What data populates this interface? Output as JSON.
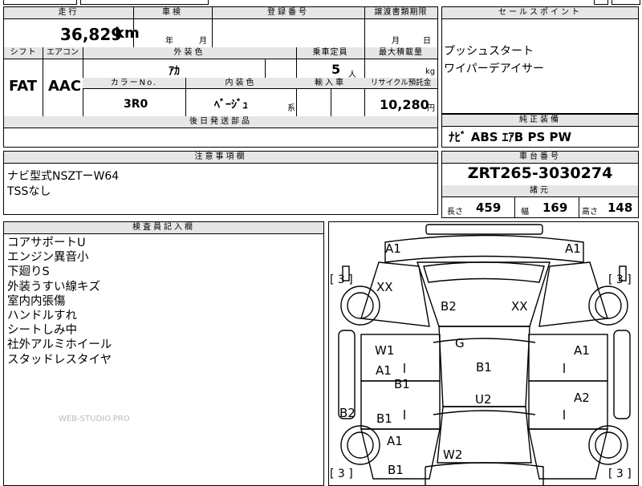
{
  "top_values": {
    "mileage": "36,829",
    "mileage_unit": "km",
    "inspection_year_unit": "年",
    "inspection_month_unit": "月",
    "transfer_month_unit": "月",
    "transfer_day_unit": "日"
  },
  "headers": {
    "mileage": "走行",
    "inspection": "車検",
    "registration": "登録番号",
    "transfer_deadline": "譲渡書類期限",
    "sales_point": "セールスポイント",
    "shift": "シフト",
    "aircon": "エアコン",
    "exterior_color": "外装色",
    "capacity": "乗車定員",
    "max_load": "最大積載量",
    "color_no": "カラーNo.",
    "interior_color": "内装色",
    "import": "輸入車",
    "recycle": "リサイクル預託金",
    "later_parts": "後日発送部品",
    "genuine_equipment": "純正装備",
    "notes": "注意事項欄",
    "chassis_no": "車台番号",
    "specs": "諸元",
    "inspector": "検査員記入欄"
  },
  "vehicle": {
    "shift": "FAT",
    "aircon": "AAC",
    "exterior_color": "ｱｶ",
    "capacity": "5",
    "capacity_unit": "人",
    "max_load_unit": "kg",
    "color_no": "3R0",
    "interior_color": "ﾍﾞｰｼﾞｭ",
    "interior_suffix": "系",
    "recycle_fee": "10,280",
    "recycle_unit": "円"
  },
  "sales_points": [
    "プッシュスタート",
    "ワイパーデアイサー"
  ],
  "genuine_equipment": "ﾅﾋﾞ ABS ｴｱB PS PW",
  "notes": [
    "ナビ型式NSZTーW64",
    "TSSなし"
  ],
  "chassis_no": "ZRT265-3030274",
  "specs": {
    "length_label": "長さ",
    "length": "459",
    "width_label": "幅",
    "width": "169",
    "height_label": "高さ",
    "height": "148"
  },
  "inspector_notes": [
    "コアサポートU",
    "エンジン異音小",
    "下廻りS",
    "外装うすい線キズ",
    "室内内張傷",
    "ハンドルすれ",
    "シートしみ中",
    "社外アルミホイール",
    "スタッドレスタイヤ"
  ],
  "watermark": "WEB-STUDIO.PRO",
  "diagram": {
    "tire_marks": [
      "3",
      "3",
      "3",
      "3"
    ],
    "marks": [
      "A1",
      "A1",
      "XX",
      "B2",
      "XX",
      "W1",
      "G",
      "A1",
      "A1",
      "B1",
      "B1",
      "U2",
      "B2",
      "B1",
      "A2",
      "A1",
      "W2",
      "B1"
    ]
  }
}
